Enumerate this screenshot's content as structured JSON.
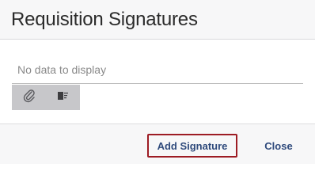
{
  "dialog": {
    "title": "Requisition Signatures"
  },
  "content": {
    "empty_message": "No data to display"
  },
  "toolbar": {
    "items": [
      {
        "icon": "paperclip-icon"
      },
      {
        "icon": "list-view-icon"
      }
    ]
  },
  "footer": {
    "add_label": "Add Signature",
    "close_label": "Close"
  },
  "colors": {
    "header_bg": "#f7f7f8",
    "toolbar_bg": "#c7c7ca",
    "button_text": "#2f4a7c",
    "focus_border": "#9d1c24"
  }
}
